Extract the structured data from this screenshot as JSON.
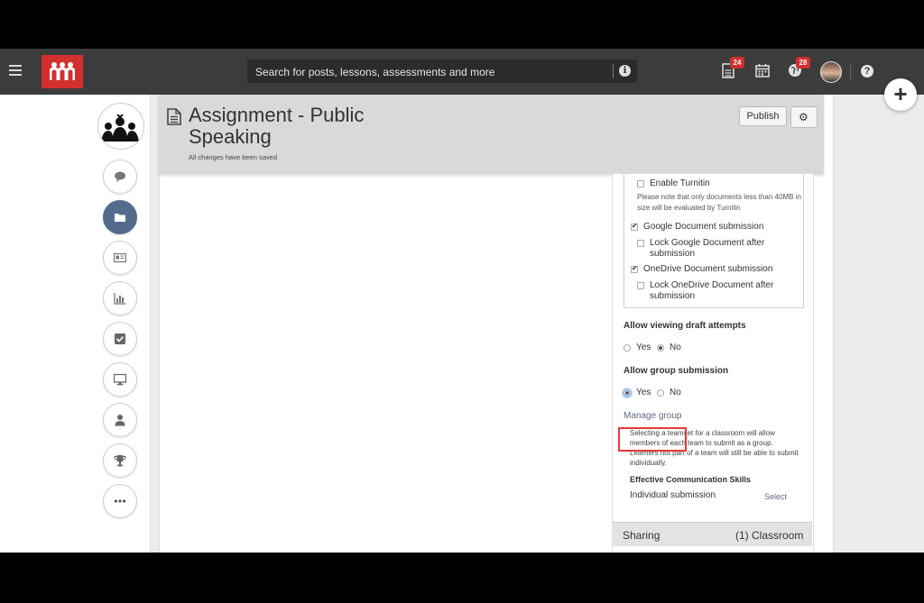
{
  "search": {
    "placeholder": "Search for posts, lessons, assessments and more"
  },
  "notifications": {
    "updates_badge": "24",
    "messages_badge": "28"
  },
  "assignment": {
    "title": "Assignment - Public Speaking",
    "save_status": "All changes have been saved",
    "publish_label": "Publish"
  },
  "settings_panel": {
    "turnitin_label": "Enable Turnitin",
    "turnitin_note": "Please note that only documents less than 40MB in size will be evaluated by Turnitin",
    "google_submission_label": "Google Document submission",
    "lock_google_label": "Lock Google Document after submission",
    "onedrive_submission_label": "OneDrive Document submission",
    "lock_onedrive_label": "Lock OneDrive Document after submission",
    "draft_attempts_label": "Allow viewing draft attempts",
    "draft_yes": "Yes",
    "draft_no": "No",
    "group_submission_label": "Allow group submission",
    "group_yes": "Yes",
    "group_no": "No",
    "manage_group_label": "Manage group",
    "teamset_note": "Selecting a teamset for a classroom will allow members of each team to submit as a group. Learners not part of a team will still be able to submit individually.",
    "classroom_name": "Effective Communication Skills",
    "submission_mode": "Individual submission",
    "select_label": "Select"
  },
  "sharing": {
    "label": "Sharing",
    "value": "(1) Classroom"
  },
  "icons": {
    "menu": "hamburger-icon",
    "updates": "document-icon",
    "calendar": "calendar-icon",
    "messages": "globe-icon",
    "help": "question-icon",
    "add": "plus-icon"
  },
  "colors": {
    "brand": "#d32f2f",
    "topbar": "#3c3c3c",
    "active_nav": "#556b8d",
    "highlight": "#e53935"
  }
}
